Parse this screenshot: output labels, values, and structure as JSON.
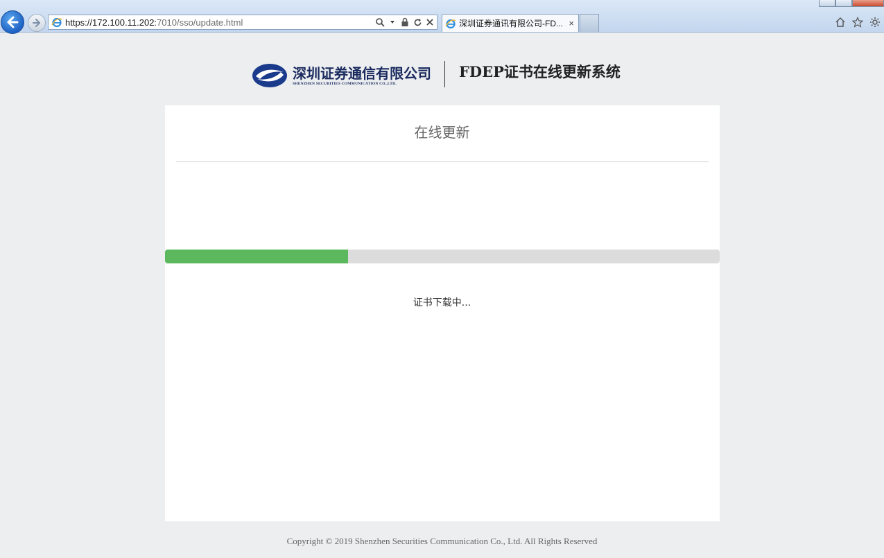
{
  "browser": {
    "url_main": "https://172.100.11.202:",
    "url_rest": "7010/sso/update.html",
    "tab_title": "深圳证券通讯有限公司-FD...",
    "tab_close": "×"
  },
  "header": {
    "brand_cn": "深圳证券通信有限公司",
    "brand_en": "SHENZHEN SECURITIES COMMUNICATION CO.,LTD.",
    "system_title": "FDEP证书在线更新系统"
  },
  "main": {
    "title": "在线更新",
    "progress_percent": 33,
    "progress_color": "#5cb85c",
    "status_text": "证书下载中..."
  },
  "footer": {
    "copyright": "Copyright © 2019 Shenzhen Securities Communication Co., Ltd. All Rights Reserved"
  }
}
